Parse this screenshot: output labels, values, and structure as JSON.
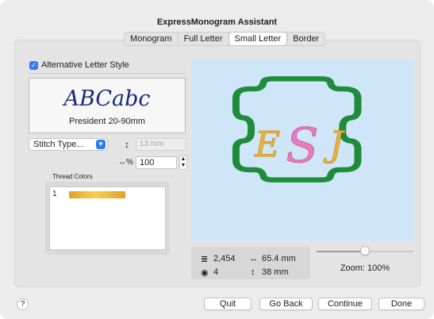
{
  "window": {
    "title": "ExpressMonogram Assistant"
  },
  "tabs": [
    {
      "label": "Monogram",
      "selected": false
    },
    {
      "label": "Full Letter",
      "selected": false
    },
    {
      "label": "Small Letter",
      "selected": true
    },
    {
      "label": "Border",
      "selected": false
    }
  ],
  "left": {
    "alt_style_checked": true,
    "alt_style_label": "Alternative Letter Style",
    "font_preview_text": "ABCabc",
    "font_name": "President 20-90mm",
    "stitch_type_label": "Stitch Type...",
    "height_value": "13 mm",
    "percent_value": "100",
    "thread_colors_label": "Thread Colors",
    "threads": [
      {
        "number": "1",
        "color": "#EDB93C"
      }
    ]
  },
  "preview": {
    "letters": [
      "E",
      "S",
      "J"
    ],
    "colors": {
      "background": "#CFE6F8",
      "border": "#1E8C3A",
      "letters": "#E8B43A",
      "center_letter": "#EA7BBF"
    }
  },
  "stats": {
    "stitches": "2,454",
    "colors": "4",
    "width": "65.4 mm",
    "height": "38 mm"
  },
  "zoom": {
    "label": "Zoom: 100%",
    "level_fraction": 0.5
  },
  "buttons": {
    "help": "?",
    "quit": "Quit",
    "go_back": "Go Back",
    "continue": "Continue",
    "done": "Done"
  }
}
